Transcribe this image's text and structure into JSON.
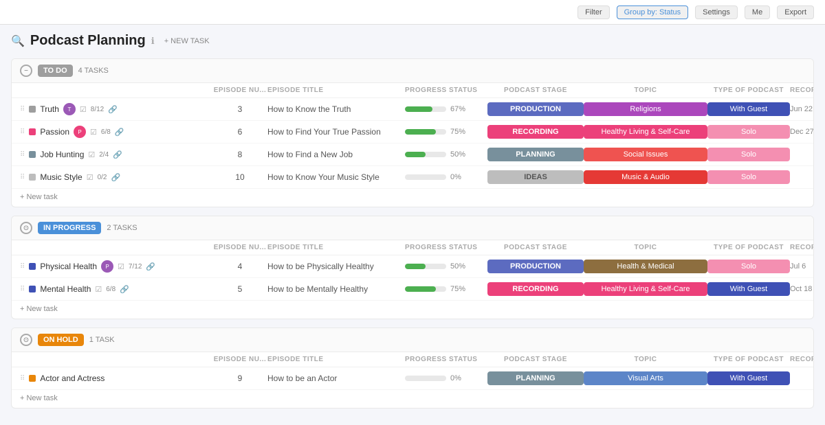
{
  "topbar": {
    "filter_label": "Filter",
    "group_label": "Group by: Status",
    "settings_label": "Settings",
    "me_label": "Me",
    "export_label": "Export"
  },
  "page": {
    "icon": "🔍",
    "title": "Podcast Planning",
    "new_task_label": "+ NEW TASK"
  },
  "sections": [
    {
      "id": "todo",
      "badge": "TO DO",
      "badge_class": "badge-todo",
      "task_count": "4 TASKS",
      "tasks": [
        {
          "name": "Truth",
          "color": "#9e9e9e",
          "avatar": "T",
          "avatar_color": "#9b59b6",
          "meta_checks": "8/12",
          "episode_num": "3",
          "episode_title": "How to Know the Truth",
          "progress": 67,
          "stage": "PRODUCTION",
          "stage_class": "stage-production",
          "topic": "Religions",
          "topic_class": "topic-religions",
          "type": "With Guest",
          "type_class": "type-guest",
          "recording_date": "Jun 22"
        },
        {
          "name": "Passion",
          "color": "#ec407a",
          "avatar": "P",
          "avatar_color": "#ec407a",
          "meta_checks": "6/8",
          "episode_num": "6",
          "episode_title": "How to Find Your True Passion",
          "progress": 75,
          "stage": "RECORDING",
          "stage_class": "stage-recording",
          "topic": "Healthy Living & Self-Care",
          "topic_class": "topic-healthy",
          "type": "Solo",
          "type_class": "type-solo-light",
          "recording_date": "Dec 27"
        },
        {
          "name": "Job Hunting",
          "color": "#78909c",
          "avatar": "",
          "avatar_color": "",
          "meta_checks": "2/4",
          "episode_num": "8",
          "episode_title": "How to Find a New Job",
          "progress": 50,
          "stage": "PLANNING",
          "stage_class": "stage-planning",
          "topic": "Social Issues",
          "topic_class": "topic-social",
          "type": "Solo",
          "type_class": "type-solo-light",
          "recording_date": ""
        },
        {
          "name": "Music Style",
          "color": "#bdbdbd",
          "avatar": "",
          "avatar_color": "",
          "meta_checks": "0/2",
          "episode_num": "10",
          "episode_title": "How to Know Your Music Style",
          "progress": 0,
          "stage": "IDEAS",
          "stage_class": "stage-ideas",
          "topic": "Music & Audio",
          "topic_class": "topic-music",
          "type": "Solo",
          "type_class": "type-solo-light",
          "recording_date": ""
        }
      ]
    },
    {
      "id": "inprogress",
      "badge": "IN PROGRESS",
      "badge_class": "badge-inprogress",
      "task_count": "2 TASKS",
      "tasks": [
        {
          "name": "Physical Health",
          "color": "#3f51b5",
          "avatar": "P",
          "avatar_color": "#9b59b6",
          "meta_checks": "7/12",
          "episode_num": "4",
          "episode_title": "How to be Physically Healthy",
          "progress": 50,
          "stage": "PRODUCTION",
          "stage_class": "stage-production",
          "topic": "Health & Medical",
          "topic_class": "topic-health-medical",
          "type": "Solo",
          "type_class": "type-solo-light",
          "recording_date": "Jul 6"
        },
        {
          "name": "Mental Health",
          "color": "#3f51b5",
          "avatar": "",
          "avatar_color": "",
          "meta_checks": "6/8",
          "episode_num": "5",
          "episode_title": "How to be Mentally Healthy",
          "progress": 75,
          "stage": "RECORDING",
          "stage_class": "stage-recording",
          "topic": "Healthy Living & Self-Care",
          "topic_class": "topic-healthy",
          "type": "With Guest",
          "type_class": "type-guest",
          "recording_date": "Oct 18"
        }
      ]
    },
    {
      "id": "onhold",
      "badge": "ON HOLD",
      "badge_class": "badge-onhold",
      "task_count": "1 TASK",
      "tasks": [
        {
          "name": "Actor and Actress",
          "color": "#e8860a",
          "avatar": "",
          "avatar_color": "",
          "meta_checks": "",
          "episode_num": "9",
          "episode_title": "How to be an Actor",
          "progress": 0,
          "stage": "PLANNING",
          "stage_class": "stage-planning",
          "topic": "Visual Arts",
          "topic_class": "topic-visual-arts",
          "type": "With Guest",
          "type_class": "type-guest",
          "recording_date": ""
        }
      ]
    }
  ],
  "col_headers": {
    "task": "",
    "episode_num": "EPISODE NU...",
    "episode_title": "EPISODE TITLE",
    "progress": "PROGRESS STATUS",
    "stage": "PODCAST STAGE",
    "topic": "TOPIC",
    "type": "TYPE OF PODCAST",
    "recording": "RECORDING"
  },
  "add_task_label": "+ New task"
}
